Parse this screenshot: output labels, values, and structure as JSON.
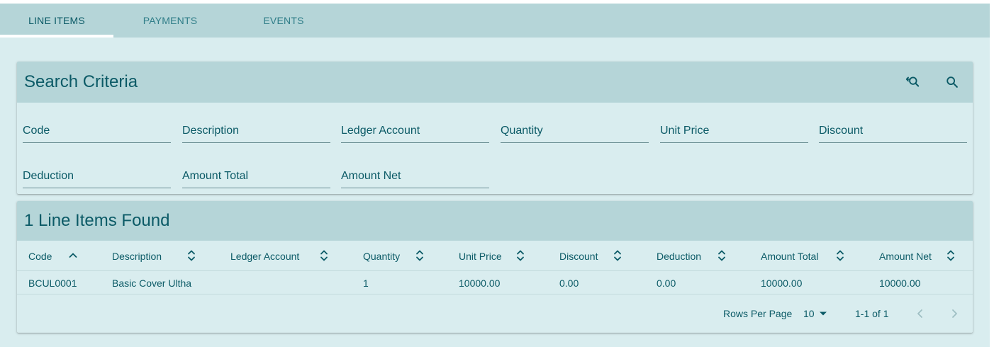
{
  "tabs": [
    {
      "label": "LINE ITEMS",
      "active": true
    },
    {
      "label": "PAYMENTS",
      "active": false
    },
    {
      "label": "EVENTS",
      "active": false
    }
  ],
  "search": {
    "title": "Search Criteria",
    "icons": [
      "search-reset-icon",
      "search-icon"
    ],
    "fields": [
      "Code",
      "Description",
      "Ledger Account",
      "Quantity",
      "Unit Price",
      "Discount",
      "Deduction",
      "Amount Total",
      "Amount Net"
    ]
  },
  "results": {
    "title": "1 Line Items Found",
    "columns": [
      {
        "label": "Code",
        "sort": "asc"
      },
      {
        "label": "Description",
        "sort": "none"
      },
      {
        "label": "Ledger Account",
        "sort": "none"
      },
      {
        "label": "Quantity",
        "sort": "none"
      },
      {
        "label": "Unit Price",
        "sort": "none"
      },
      {
        "label": "Discount",
        "sort": "none"
      },
      {
        "label": "Deduction",
        "sort": "none"
      },
      {
        "label": "Amount Total",
        "sort": "none"
      },
      {
        "label": "Amount Net",
        "sort": "none"
      }
    ],
    "rows": [
      [
        "BCUL0001",
        "Basic Cover Ultha",
        "",
        "1",
        "10000.00",
        "0.00",
        "0.00",
        "10000.00",
        "10000.00"
      ]
    ]
  },
  "pagination": {
    "rows_per_page_label": "Rows Per Page",
    "rows_per_page_value": "10",
    "range_text": "1-1 of 1"
  },
  "colors": {
    "accent": "#0b5a66",
    "header_bg": "#b5d5d8",
    "content_bg": "#d9edef"
  }
}
